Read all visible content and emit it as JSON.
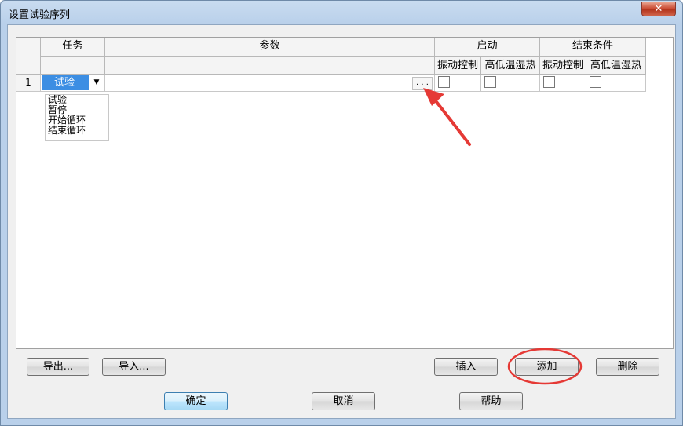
{
  "window": {
    "title": "设置试验序列",
    "close_glyph": "✕"
  },
  "grid": {
    "columns": {
      "task": "任务",
      "params": "参数",
      "start_group": "启动",
      "end_group": "结束条件",
      "vibration_control": "振动控制",
      "temp_humidity": "高低温湿热"
    },
    "rows": [
      {
        "num": "1",
        "task": "试验",
        "params_button": ". . ."
      }
    ]
  },
  "dropdown": {
    "options": [
      "试验",
      "暂停",
      "开始循环",
      "结束循环"
    ]
  },
  "buttons": {
    "export": "导出...",
    "import": "导入...",
    "insert": "插入",
    "add": "添加",
    "delete": "删除",
    "ok": "确定",
    "cancel": "取消",
    "help": "帮助"
  },
  "colors": {
    "annotation_red": "#e53935",
    "selection_blue": "#3c8ee3"
  }
}
